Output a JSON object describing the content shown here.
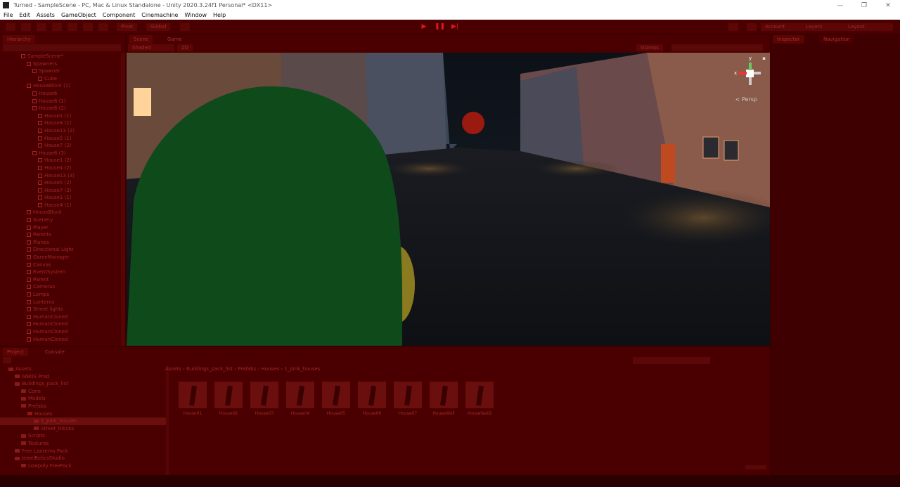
{
  "window": {
    "title": "Turned - SampleScene - PC, Mac & Linux Standalone - Unity 2020.3.24f1 Personal* <DX11>",
    "minimize": "—",
    "maximize": "❐",
    "close": "✕"
  },
  "menu": [
    "File",
    "Edit",
    "Assets",
    "GameObject",
    "Component",
    "Cinemachine",
    "Window",
    "Help"
  ],
  "toolbar": {
    "pivot": "Pivot",
    "global": "Global",
    "account": "Account",
    "layers": "Layers",
    "layout": "Layout"
  },
  "hierarchy": {
    "tab": "Hierarchy",
    "items": [
      {
        "label": "SampleScene*",
        "indent": 0
      },
      {
        "label": "Spawners",
        "indent": 1
      },
      {
        "label": "Spawner",
        "indent": 2
      },
      {
        "label": "Cube",
        "indent": 3
      },
      {
        "label": "HouseBlock (1)",
        "indent": 1
      },
      {
        "label": "House6",
        "indent": 2
      },
      {
        "label": "House6 (1)",
        "indent": 2
      },
      {
        "label": "House6 (2)",
        "indent": 2
      },
      {
        "label": "House1 (1)",
        "indent": 3
      },
      {
        "label": "House4 (1)",
        "indent": 3
      },
      {
        "label": "House13 (2)",
        "indent": 3
      },
      {
        "label": "House5 (1)",
        "indent": 3
      },
      {
        "label": "House7 (2)",
        "indent": 3
      },
      {
        "label": "House6 (3)",
        "indent": 2
      },
      {
        "label": "House1 (2)",
        "indent": 3
      },
      {
        "label": "House4 (2)",
        "indent": 3
      },
      {
        "label": "House13 (3)",
        "indent": 3
      },
      {
        "label": "House5 (2)",
        "indent": 3
      },
      {
        "label": "House7 (3)",
        "indent": 3
      },
      {
        "label": "House1 (1)",
        "indent": 3
      },
      {
        "label": "House4 (1)",
        "indent": 3
      },
      {
        "label": "HouseBlock",
        "indent": 1
      },
      {
        "label": "Scenery",
        "indent": 1
      },
      {
        "label": "Player",
        "indent": 1
      },
      {
        "label": "Parents",
        "indent": 1
      },
      {
        "label": "Planes",
        "indent": 1
      },
      {
        "label": "Directional Light",
        "indent": 1
      },
      {
        "label": "GameManager",
        "indent": 1
      },
      {
        "label": "Canvas",
        "indent": 1
      },
      {
        "label": "EventSystem",
        "indent": 1
      },
      {
        "label": "Parent",
        "indent": 1
      },
      {
        "label": "Cameras",
        "indent": 1
      },
      {
        "label": "Lamps",
        "indent": 1
      },
      {
        "label": "Lanterns",
        "indent": 1
      },
      {
        "label": "Street lights",
        "indent": 1
      },
      {
        "label": "HumanCloned",
        "indent": 1
      },
      {
        "label": "HumanCloned",
        "indent": 1
      },
      {
        "label": "HumanCloned",
        "indent": 1
      },
      {
        "label": "HumanCloned",
        "indent": 1
      }
    ]
  },
  "scene": {
    "tab_scene": "Scene",
    "tab_game": "Game",
    "shading": "Shaded",
    "mode_2d": "2D",
    "gizmos": "Gizmos",
    "persp": "Persp",
    "axis_x": "x",
    "axis_y": "y"
  },
  "right_tabs": {
    "inspector": "Inspector",
    "navigation": "Navigation"
  },
  "project": {
    "tab_project": "Project",
    "tab_console": "Console",
    "breadcrumb": [
      "Assets",
      "Buildings_pack_list",
      "Prefabs",
      "Houses",
      "1_pink_houses"
    ],
    "tree": [
      {
        "label": "Assets",
        "indent": 0
      },
      {
        "label": "ANKIS Prod",
        "indent": 1
      },
      {
        "label": "Buildings_pack_list",
        "indent": 1
      },
      {
        "label": "Cone",
        "indent": 2
      },
      {
        "label": "Models",
        "indent": 2
      },
      {
        "label": "Prefabs",
        "indent": 2
      },
      {
        "label": "Houses",
        "indent": 3
      },
      {
        "label": "1_pink_houses",
        "indent": 4
      },
      {
        "label": "Street_blocks",
        "indent": 4
      },
      {
        "label": "Scripts",
        "indent": 2
      },
      {
        "label": "Textures",
        "indent": 2
      },
      {
        "label": "Free Lanterns Pack",
        "indent": 1
      },
      {
        "label": "JewelRelicsStudio",
        "indent": 1
      },
      {
        "label": "Lowpoly FreePack",
        "indent": 2
      }
    ],
    "assets": [
      "House01",
      "House02",
      "House03",
      "House04",
      "House05",
      "House06",
      "House07",
      "HouseWall",
      "HouseWall2"
    ]
  }
}
